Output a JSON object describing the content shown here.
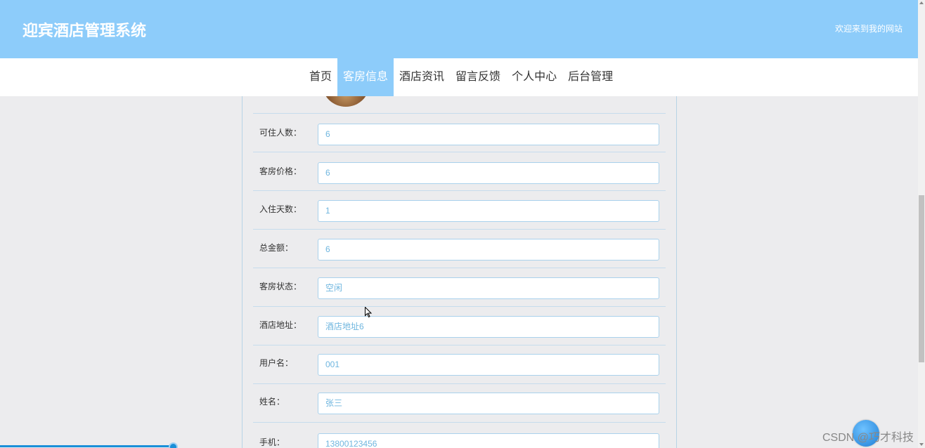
{
  "header": {
    "site_title": "迎宾酒店管理系统",
    "welcome": "欢迎来到我的网站"
  },
  "nav": {
    "items": [
      {
        "label": "首页"
      },
      {
        "label": "客房信息"
      },
      {
        "label": "酒店资讯"
      },
      {
        "label": "留言反馈"
      },
      {
        "label": "个人中心"
      },
      {
        "label": "后台管理"
      }
    ],
    "active_index": 1
  },
  "form": {
    "rows": [
      {
        "label": "可住人数：",
        "value": "6"
      },
      {
        "label": "客房价格：",
        "value": "6"
      },
      {
        "label": "入住天数：",
        "value": "1"
      },
      {
        "label": "总金额：",
        "value": "6"
      },
      {
        "label": "客房状态：",
        "value": "空闲"
      },
      {
        "label": "酒店地址：",
        "value": "酒店地址6"
      },
      {
        "label": "用户名：",
        "value": "001"
      },
      {
        "label": "姓名：",
        "value": "张三"
      },
      {
        "label": "手机：",
        "value": "13800123456"
      }
    ]
  },
  "watermark": "CSDN @巧才科技",
  "colors": {
    "header_bg": "#8dccfa",
    "nav_active_bg": "#8dccfa",
    "input_text": "#6fb6df",
    "page_bg": "#ececee"
  },
  "progress": {
    "value": 0.19
  }
}
